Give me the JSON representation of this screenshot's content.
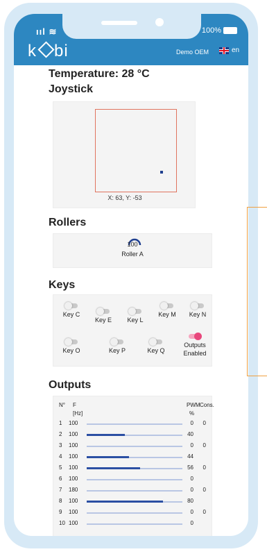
{
  "status": {
    "signal": "ııl",
    "battery": "100%"
  },
  "header": {
    "logo": "kobi",
    "brand": "Demo OEM",
    "lang": "en"
  },
  "temperature": "Temperature: 28 °C",
  "joystick": {
    "title": "Joystick",
    "x": 63,
    "y": -53,
    "coord_label": "X: 63, Y: -53"
  },
  "rollers": {
    "title": "Rollers",
    "items": [
      {
        "value": "100",
        "name": "Roller A",
        "level": 1.0
      }
    ]
  },
  "keys": {
    "title": "Keys",
    "items": [
      {
        "label": "Key C",
        "on": false
      },
      {
        "label": "Key E",
        "on": false
      },
      {
        "label": "Key L",
        "on": false
      },
      {
        "label": "Key M",
        "on": false
      },
      {
        "label": "Key N",
        "on": false
      },
      {
        "label": "Key O",
        "on": false
      },
      {
        "label": "Key P",
        "on": false
      },
      {
        "label": "Key Q",
        "on": false
      },
      {
        "label": "Outputs Enabled",
        "on": true
      }
    ]
  },
  "outputs": {
    "title": "Outputs",
    "headers": {
      "n": "N°",
      "f": "F",
      "f_unit": "[Hz]",
      "pwm": "PWM",
      "pwm_unit": "%",
      "cons": "Cons."
    },
    "rows": [
      {
        "n": "1",
        "f": "100",
        "pwm": "0",
        "cons": "0",
        "level": 0
      },
      {
        "n": "2",
        "f": "100",
        "pwm": "40",
        "cons": "",
        "level": 40
      },
      {
        "n": "3",
        "f": "100",
        "pwm": "0",
        "cons": "0",
        "level": 0
      },
      {
        "n": "4",
        "f": "100",
        "pwm": "44",
        "cons": "",
        "level": 44
      },
      {
        "n": "5",
        "f": "100",
        "pwm": "56",
        "cons": "0",
        "level": 56
      },
      {
        "n": "6",
        "f": "100",
        "pwm": "0",
        "cons": "",
        "level": 0
      },
      {
        "n": "7",
        "f": "180",
        "pwm": "0",
        "cons": "0",
        "level": 0
      },
      {
        "n": "8",
        "f": "100",
        "pwm": "80",
        "cons": "",
        "level": 80
      },
      {
        "n": "9",
        "f": "100",
        "pwm": "0",
        "cons": "0",
        "level": 0
      },
      {
        "n": "10",
        "f": "100",
        "pwm": "0",
        "cons": "",
        "level": 0
      }
    ]
  },
  "colors": {
    "accent": "#2d87c1",
    "toggle_on": "#e8477c",
    "joystick_frame": "#e0735e",
    "bar": "#2b4fa3"
  }
}
